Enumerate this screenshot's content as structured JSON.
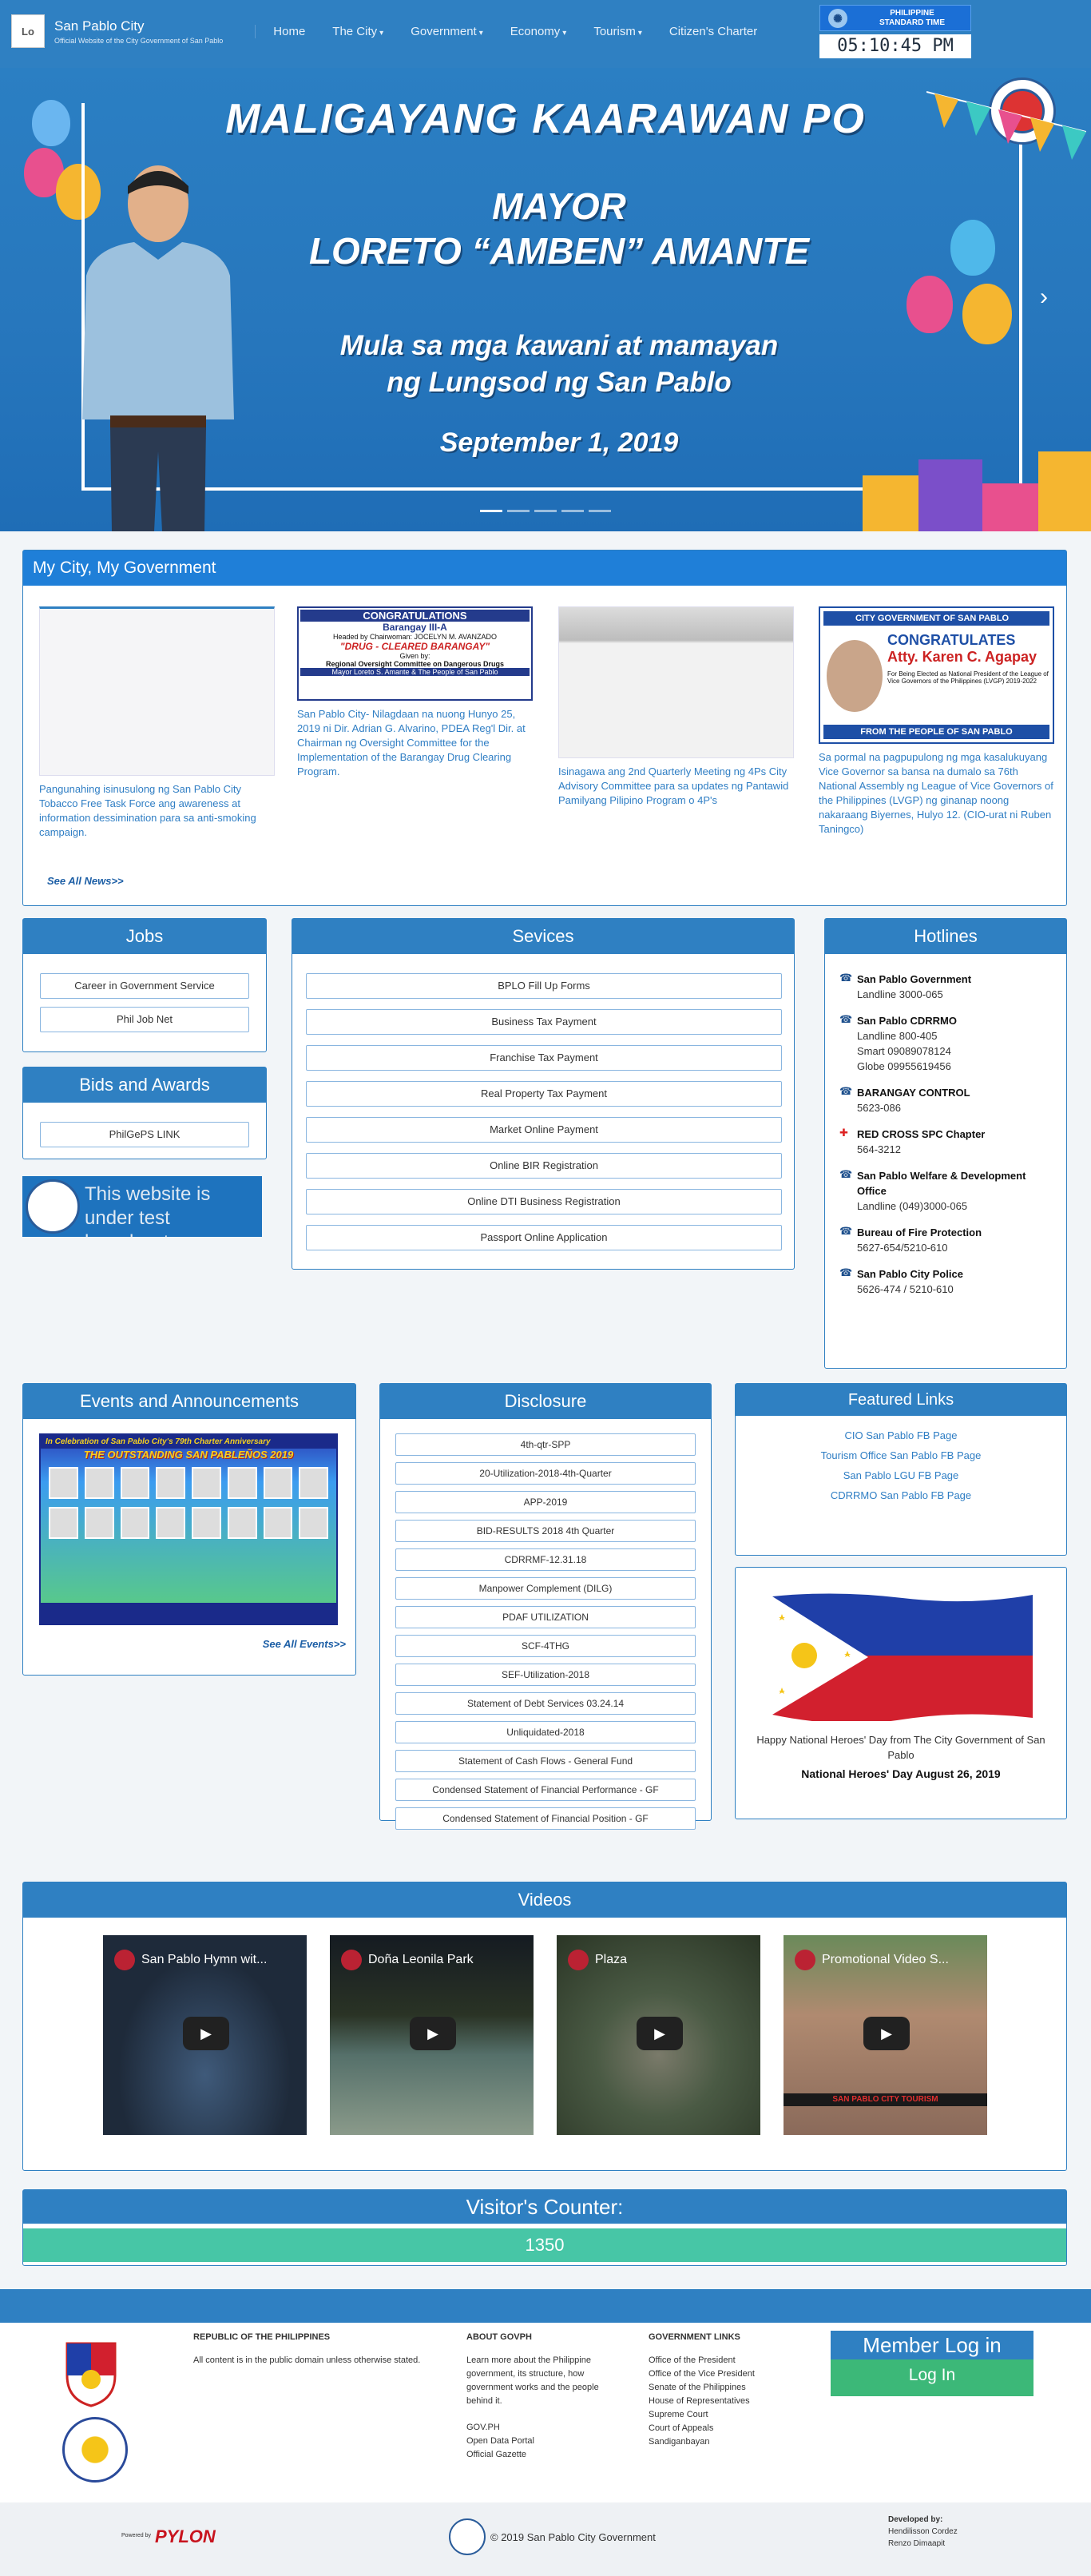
{
  "nav": {
    "logo_alt": "Lo",
    "site_title": "San Pablo City",
    "site_subtitle": "Official Website of the City Government of San Pablo",
    "menu": [
      {
        "label": "Home",
        "caret": ""
      },
      {
        "label": "The City",
        "caret": "▾"
      },
      {
        "label": "Government",
        "caret": "▾"
      },
      {
        "label": "Economy",
        "caret": "▾"
      },
      {
        "label": "Tourism",
        "caret": "▾"
      },
      {
        "label": "Citizen's Charter",
        "caret": ""
      }
    ],
    "pst_line1": "PHILIPPINE",
    "pst_line2": "STANDARD TIME",
    "time": "05:10:45 PM"
  },
  "hero": {
    "headline": "MALIGAYANG KAARAWAN PO",
    "mayor_line1": "MAYOR",
    "mayor_line2": "LORETO “AMBEN” AMANTE",
    "message_line1": "Mula sa mga kawani at mamayan",
    "message_line2": "ng Lungsod ng San Pablo",
    "date": "September 1, 2019",
    "seal_text": "CITY OF SAN PABLO · OFFICIAL SEAL",
    "slides": 5,
    "active_slide": 0
  },
  "my_city": {
    "title": "My City, My Government",
    "news": [
      {
        "text": "Pangunahing isinusulong ng San Pablo City Tobacco Free Task Force ang awareness at information dessimination para sa anti-smoking campaign."
      },
      {
        "image_text": [
          "CONGRATULATIONS",
          "Barangay III-A",
          "Headed by Chairwoman: JOCELYN M. AVANZADO",
          "\"DRUG - CLEARED BARANGAY\"",
          "Given by:",
          "Regional Oversight Committee on Dangerous Drugs",
          "Mayor Loreto S. Amante & The People of San Pablo"
        ],
        "text": "San Pablo City- Nilagdaan na nuong Hunyo 25, 2019 ni Dir. Adrian G. Alvarino, PDEA Reg'l Dir. at Chairman ng Oversight Committee for the Implementation of the Barangay Drug Clearing Program."
      },
      {
        "text": "Isinagawa ang 2nd Quarterly Meeting ng 4Ps City Advisory Committee para sa updates ng Pantawid Pamilyang Pilipino Program o 4P's"
      },
      {
        "image_text": [
          "CITY GOVERNMENT OF SAN PABLO",
          "CONGRATULATES",
          "Atty. Karen C. Agapay",
          "For Being Elected as National President of the League of Vice Governors of the Philippines (LVGP) 2019-2022",
          "FROM THE PEOPLE OF SAN PABLO"
        ],
        "text": "Sa pormal na pagpupulong ng mga kasalukuyang Vice Governor sa bansa na dumalo sa 76th National Assembly ng League of Vice Governors of the Philippines (LVGP) ng ginanap noong nakaraang Biyernes, Hulyo 12. (CIO-urat ni Ruben Taningco)"
      }
    ],
    "see_all": "See All News>>"
  },
  "jobs": {
    "title": "Jobs",
    "items": [
      "Career in Government Service",
      "Phil Job Net"
    ]
  },
  "bids": {
    "title": "Bids and Awards",
    "items": [
      "PhilGePS LINK"
    ]
  },
  "broadcast": {
    "text": "This website is under test broadcast."
  },
  "services": {
    "title": "Sevices",
    "items": [
      "BPLO Fill Up Forms",
      "Business Tax Payment",
      "Franchise Tax Payment",
      "Real Property Tax Payment",
      "Market Online Payment",
      "Online BIR Registration",
      "Online DTI Business Registration",
      "Passport Online Application"
    ]
  },
  "hotlines": {
    "title": "Hotlines",
    "items": [
      {
        "icon": "☎",
        "name": "San Pablo Government",
        "lines": [
          "Landline 3000-065"
        ]
      },
      {
        "icon": "☎",
        "name": "San Pablo CDRRMO",
        "lines": [
          "Landline 800-405",
          "Smart 09089078124",
          "Globe 09955619456"
        ]
      },
      {
        "icon": "☎",
        "name": "BARANGAY CONTROL",
        "lines": [
          "5623-086"
        ]
      },
      {
        "icon": "✚",
        "name": "RED CROSS SPC Chapter",
        "lines": [
          "564-3212"
        ]
      },
      {
        "icon": "☎",
        "name": "San Pablo Welfare & Development Office",
        "lines": [
          "Landline (049)3000-065"
        ]
      },
      {
        "icon": "☎",
        "name": "Bureau of Fire Protection",
        "lines": [
          "5627-654/5210-610"
        ]
      },
      {
        "icon": "☎",
        "name": "San Pablo City Police",
        "lines": [
          "5626-474 / 5210-610"
        ]
      }
    ]
  },
  "events": {
    "title": "Events and Announcements",
    "poster_title": "In Celebration of San Pablo City's 79th Charter Anniversary",
    "poster_subtitle": "THE OUTSTANDING SAN PABLEÑOS 2019",
    "see_all": "See All Events>>"
  },
  "disclosure": {
    "title": "Disclosure",
    "items": [
      "4th-qtr-SPP",
      "20-Utilization-2018-4th-Quarter",
      "APP-2019",
      "BID-RESULTS 2018 4th Quarter",
      "CDRRMF-12.31.18",
      "Manpower Complement (DILG)",
      "PDAF UTILIZATION",
      "SCF-4THG",
      "SEF-Utilization-2018",
      "Statement of Debt Services 03.24.14",
      "Unliquidated-2018",
      "Statement of Cash Flows - General Fund",
      "Condensed Statement of Financial Performance - GF",
      "Condensed Statement of Financial Position - GF"
    ]
  },
  "featured": {
    "title": "Featured Links",
    "links": [
      "CIO San Pablo FB Page",
      "Tourism Office San Pablo FB Page",
      "San Pablo LGU FB Page",
      "CDRRMO San Pablo FB Page"
    ],
    "caption": "Happy National Heroes' Day from The City Government of San Pablo",
    "caption_bold": "National Heroes' Day August 26, 2019"
  },
  "videos": {
    "title": "Videos",
    "items": [
      {
        "title": "San Pablo Hymn wit...",
        "bg": "#1e2a3a"
      },
      {
        "title": "Doña Leonila Park",
        "bg": "#4a5a4a"
      },
      {
        "title": "Plaza",
        "bg": "#3d4a3d"
      },
      {
        "title": "Promotional Video S...",
        "bg": "#5a4a44"
      }
    ],
    "banner_text": "SAN PABLO CITY TOURISM"
  },
  "visitor": {
    "title": "Visitor's Counter:",
    "count": "1350"
  },
  "footer": {
    "rp_title": "REPUBLIC OF THE PHILIPPINES",
    "rp_text": "All content is in the public domain unless otherwise stated.",
    "about_title": "ABOUT GOVPH",
    "about_text": "Learn more about the Philippine government, its structure, how government works and the people behind it.",
    "about_links": [
      "GOV.PH",
      "Open Data Portal",
      "Official Gazette"
    ],
    "gov_title": "GOVERNMENT LINKS",
    "gov_links": [
      "Office of the President",
      "Office of the Vice President",
      "Senate of the Philippines",
      "House of Representatives",
      "Supreme Court",
      "Court of Appeals",
      "Sandiganbayan"
    ],
    "member_title": "Member Log in",
    "login_label": "Log In",
    "powered_label": "Powered by",
    "powered_brand": "PYLON",
    "copyright": "© 2019 San Pablo City Government",
    "dev_title": "Developed by:",
    "devs": [
      "Hendilisson Cordez",
      "Renzo Dimaapit"
    ]
  }
}
